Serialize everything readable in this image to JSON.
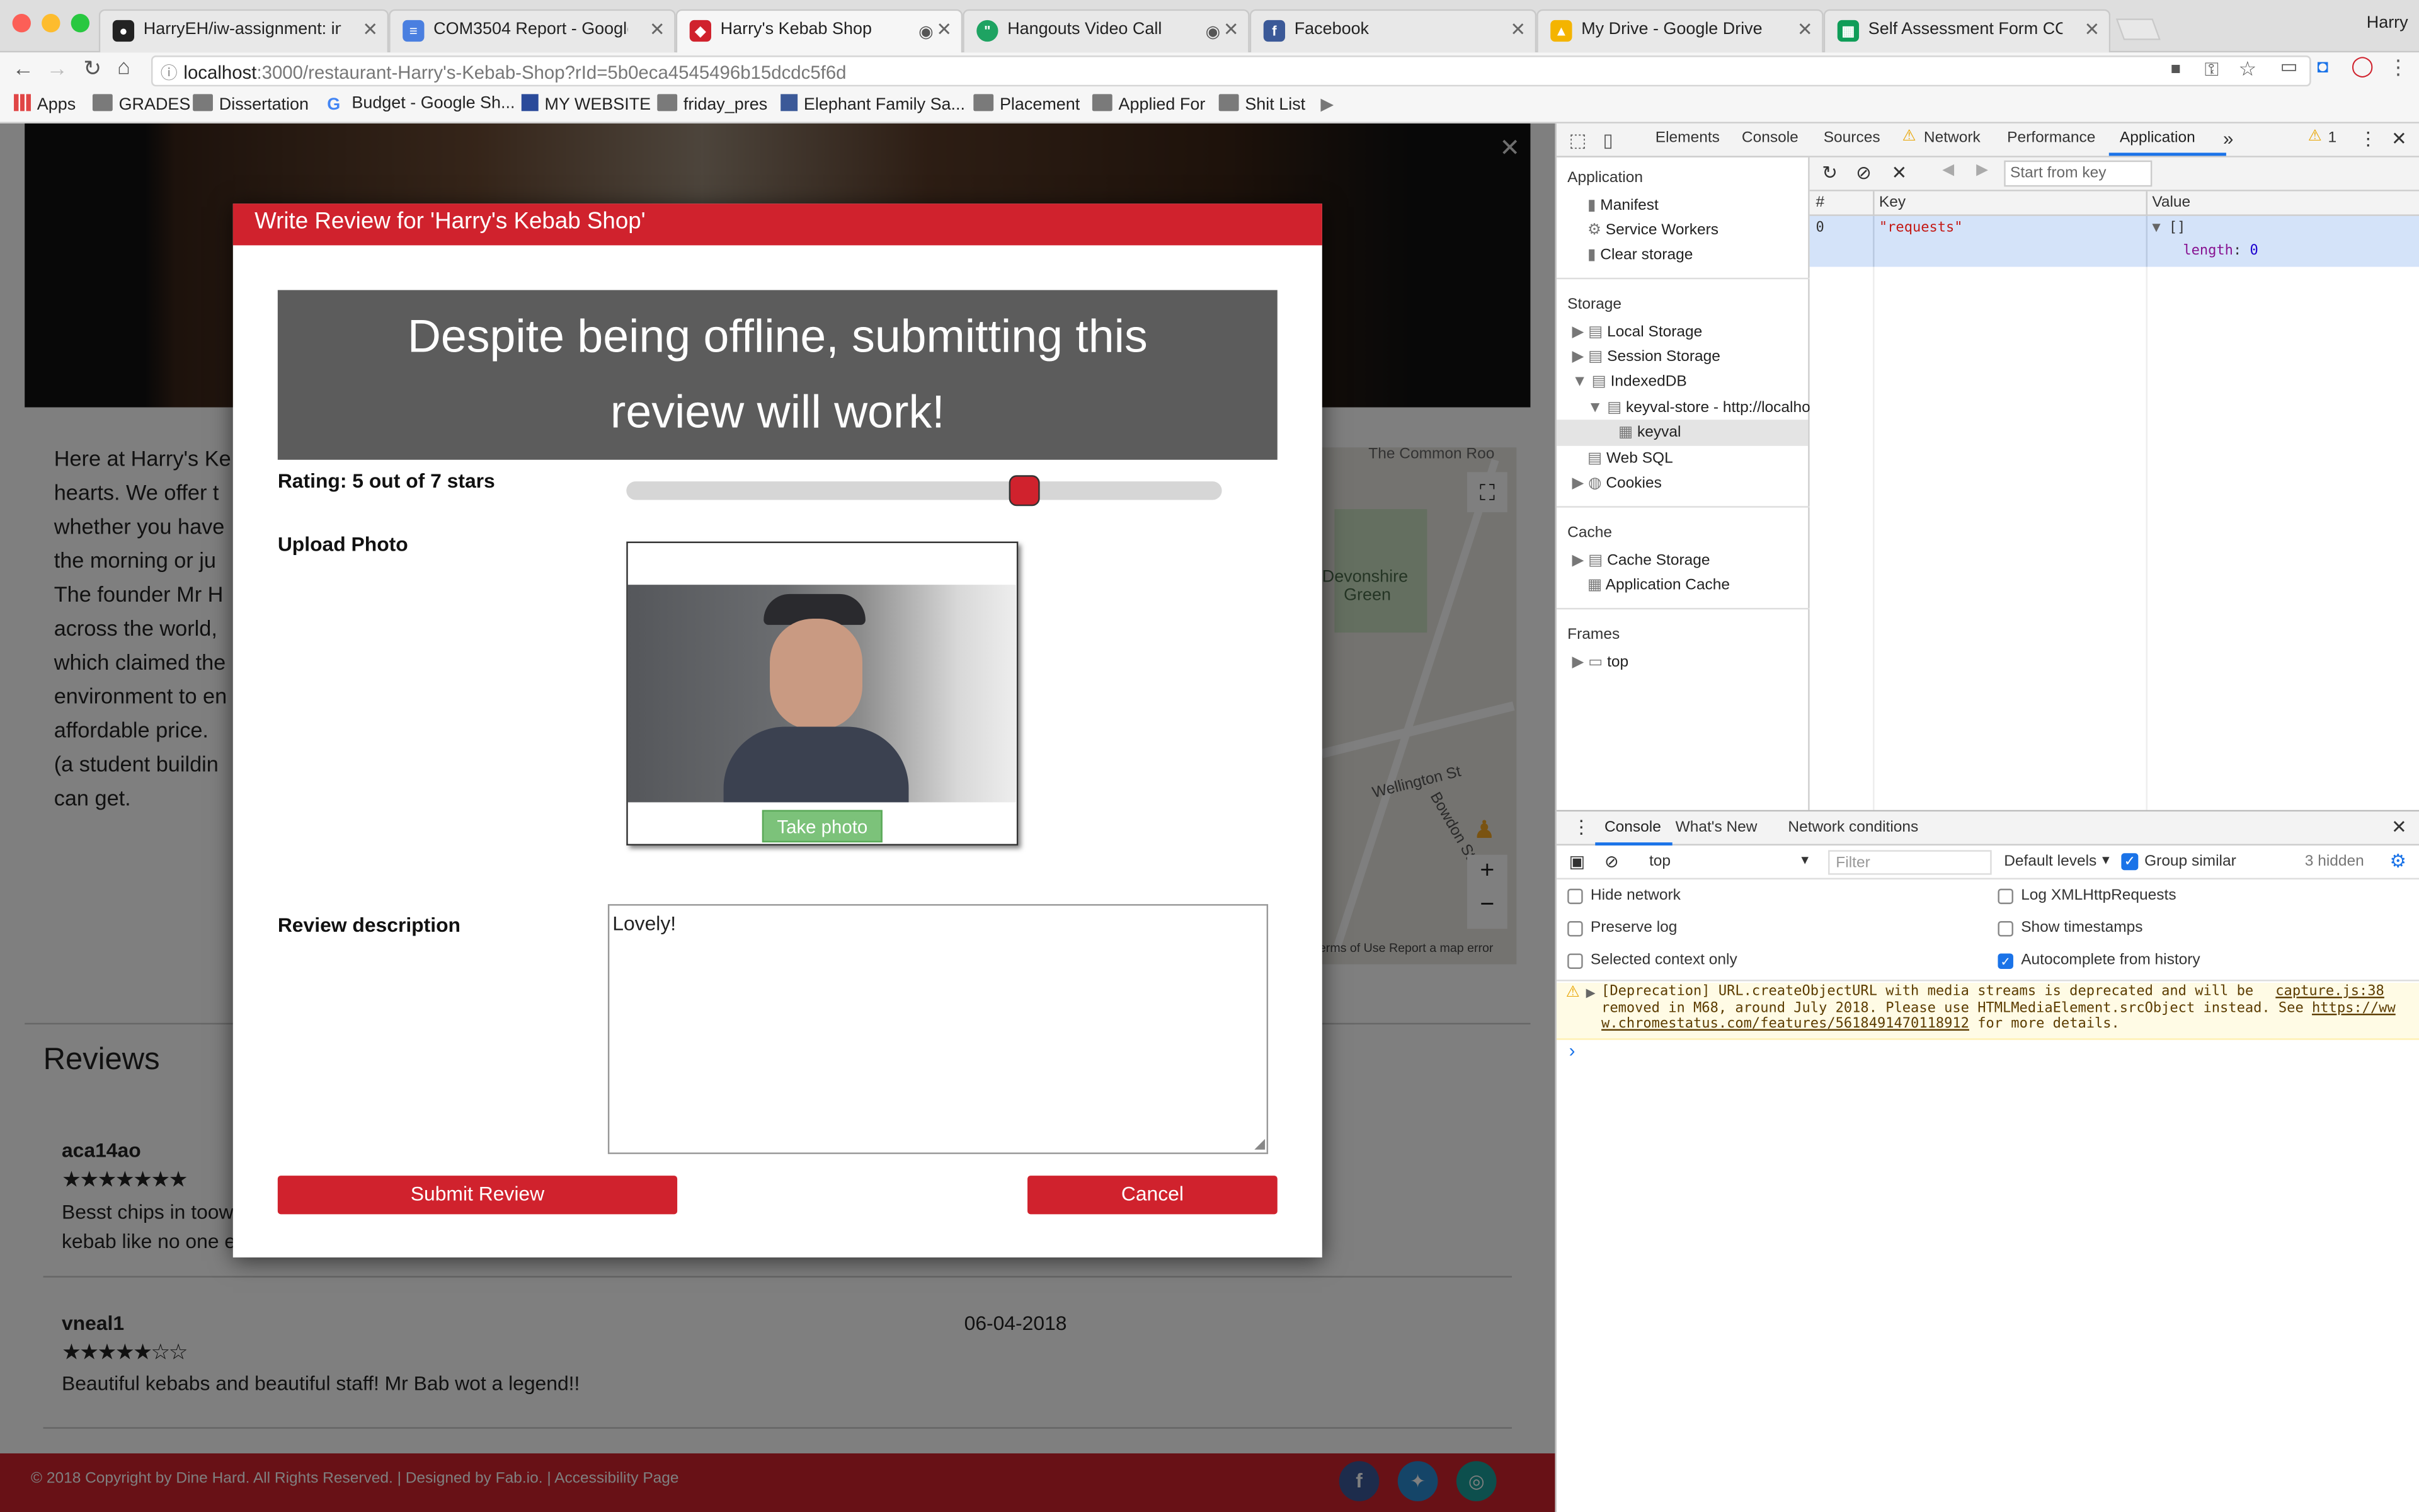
{
  "browser": {
    "profile_name": "Harry",
    "tabs": [
      {
        "title": "HarryEH/iw-assignment: intelli",
        "icon": "github-icon"
      },
      {
        "title": "COM3504 Report - Google Do",
        "icon": "google-docs-icon"
      },
      {
        "title": "Harry's Kebab Shop",
        "icon": "site-icon"
      },
      {
        "title": "Hangouts Video Call",
        "icon": "hangouts-icon"
      },
      {
        "title": "Facebook",
        "icon": "facebook-icon"
      },
      {
        "title": "My Drive - Google Drive",
        "icon": "google-drive-icon"
      },
      {
        "title": "Self Assessment Form COM35",
        "icon": "google-sheets-icon"
      }
    ],
    "url_host": "localhost",
    "url_rest": ":3000/restaurant-Harry's-Kebab-Shop?rId=5b0eca4545496b15dcdc5f6d",
    "bookmarks": [
      "Apps",
      "GRADES",
      "Dissertation",
      "Budget - Google Sh...",
      "MY WEBSITE",
      "friday_pres",
      "Elephant Family Sa...",
      "Placement",
      "Applied For",
      "Shit List"
    ]
  },
  "page": {
    "about_lines": [
      "Here at Harry's Ke",
      "hearts. We offer t",
      "whether you have",
      "the morning or ju",
      "The founder Mr H",
      "across the world,",
      "which claimed the",
      "environment to en",
      "affordable price.",
      "(a student buildin",
      "can get."
    ],
    "map": {
      "labels": [
        "The Common Roo",
        "Devonshire",
        "Green",
        "Wellington St",
        "Bowdon St"
      ],
      "attribution": "erms of Use   Report a map error"
    },
    "reviews_heading": "Reviews",
    "reviews": [
      {
        "user": "aca14ao",
        "rating": 7,
        "max": 7,
        "date": "",
        "text_lines": [
          "Besst chips in toow",
          "kebab like no one e"
        ]
      },
      {
        "user": "vneal1",
        "rating": 5,
        "max": 7,
        "date": "06-04-2018",
        "text_lines": [
          "Beautiful kebabs and beautiful staff! Mr Bab wot a legend!!"
        ]
      }
    ],
    "footer_text": "© 2018 Copyright by Dine Hard. All Rights Reserved. | Designed by Fab.io. | Accessibility Page",
    "social": [
      "facebook-icon",
      "twitter-icon",
      "instagram-icon"
    ]
  },
  "modal": {
    "title": "Write Review for 'Harry's Kebab Shop'",
    "banner_line1": "Despite being offline, submitting this",
    "banner_line2": "review will work!",
    "rating_label": "Rating: 5 out of 7 stars",
    "rating_value": 5,
    "rating_max": 7,
    "upload_label": "Upload Photo",
    "take_photo": "Take photo",
    "description_label": "Review description",
    "description_value": "Lovely!",
    "submit": "Submit Review",
    "cancel": "Cancel"
  },
  "devtools": {
    "tabs": [
      "Elements",
      "Console",
      "Sources",
      "Network",
      "Performance",
      "Application"
    ],
    "warnings": "1",
    "filter_placeholder": "Start from key",
    "sidebar": {
      "application_header": "Application",
      "application_items": [
        "Manifest",
        "Service Workers",
        "Clear storage"
      ],
      "storage_header": "Storage",
      "storage_items": [
        "Local Storage",
        "Session Storage",
        "IndexedDB",
        "keyval-store - http://localho",
        "keyval",
        "Web SQL",
        "Cookies"
      ],
      "cache_header": "Cache",
      "cache_items": [
        "Cache Storage",
        "Application Cache"
      ],
      "frames_header": "Frames",
      "frames_items": [
        "top"
      ]
    },
    "table": {
      "columns": [
        "#",
        "Key",
        "Value"
      ],
      "rows": [
        {
          "index": "0",
          "key": "\"requests\"",
          "value": "[]",
          "value_detail_key": "length",
          "value_detail_val": "0"
        }
      ]
    },
    "drawer": {
      "tabs": [
        "Console",
        "What's New",
        "Network conditions"
      ],
      "context": "top",
      "filter_placeholder": "Filter",
      "levels": "Default levels",
      "group_similar": "Group similar",
      "hidden": "3 hidden",
      "options_left": [
        {
          "label": "Hide network",
          "checked": false
        },
        {
          "label": "Preserve log",
          "checked": false
        },
        {
          "label": "Selected context only",
          "checked": false
        }
      ],
      "options_right": [
        {
          "label": "Log XMLHttpRequests",
          "checked": false
        },
        {
          "label": "Show timestamps",
          "checked": false
        },
        {
          "label": "Autocomplete from history",
          "checked": true
        }
      ],
      "warning_line1": "[Deprecation] URL.createObjectURL with media streams is deprecated and will be",
      "warning_link": "capture.js:38",
      "warning_line2a": "removed in M68, around July 2018. Please use HTMLMediaElement.srcObject instead. See ",
      "warning_url1": "https://ww",
      "warning_url2": "w.chromestatus.com/features/5618491470118912",
      "warning_line3": " for more details.",
      "prompt": "›"
    }
  },
  "colors": {
    "brand_red": "#d0222d",
    "link_blue": "#1a1aa6",
    "checkbox_blue": "#1a73e8"
  }
}
